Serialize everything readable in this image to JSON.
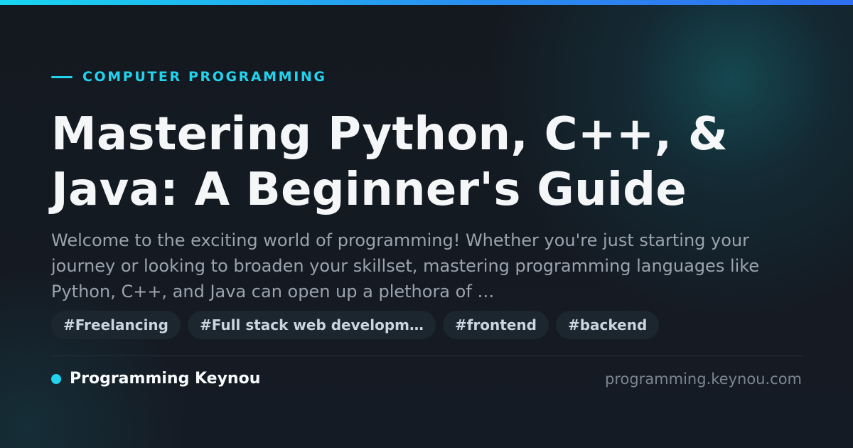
{
  "category": "COMPUTER PROGRAMMING",
  "title": "Mastering Python, C++, & Java: A Beginner's Guide",
  "excerpt": "Welcome to the exciting world of programming! Whether you're just starting your journey or looking to broaden your skillset, mastering programming languages like Python, C++, and Java can open up a plethora of …",
  "tags": [
    "#Freelancing",
    "#Full stack web developm…",
    "#frontend",
    "#backend"
  ],
  "brand": {
    "name": "Programming Keynou"
  },
  "site_url": "programming.keynou.com",
  "colors": {
    "accent": "#22d3ee",
    "background": "#141a22",
    "title": "#f4f6f8",
    "excerpt": "#9aa3ae",
    "tag_background": "#1c262f",
    "tag_text": "#cbd5e1",
    "url": "#7c8591"
  }
}
